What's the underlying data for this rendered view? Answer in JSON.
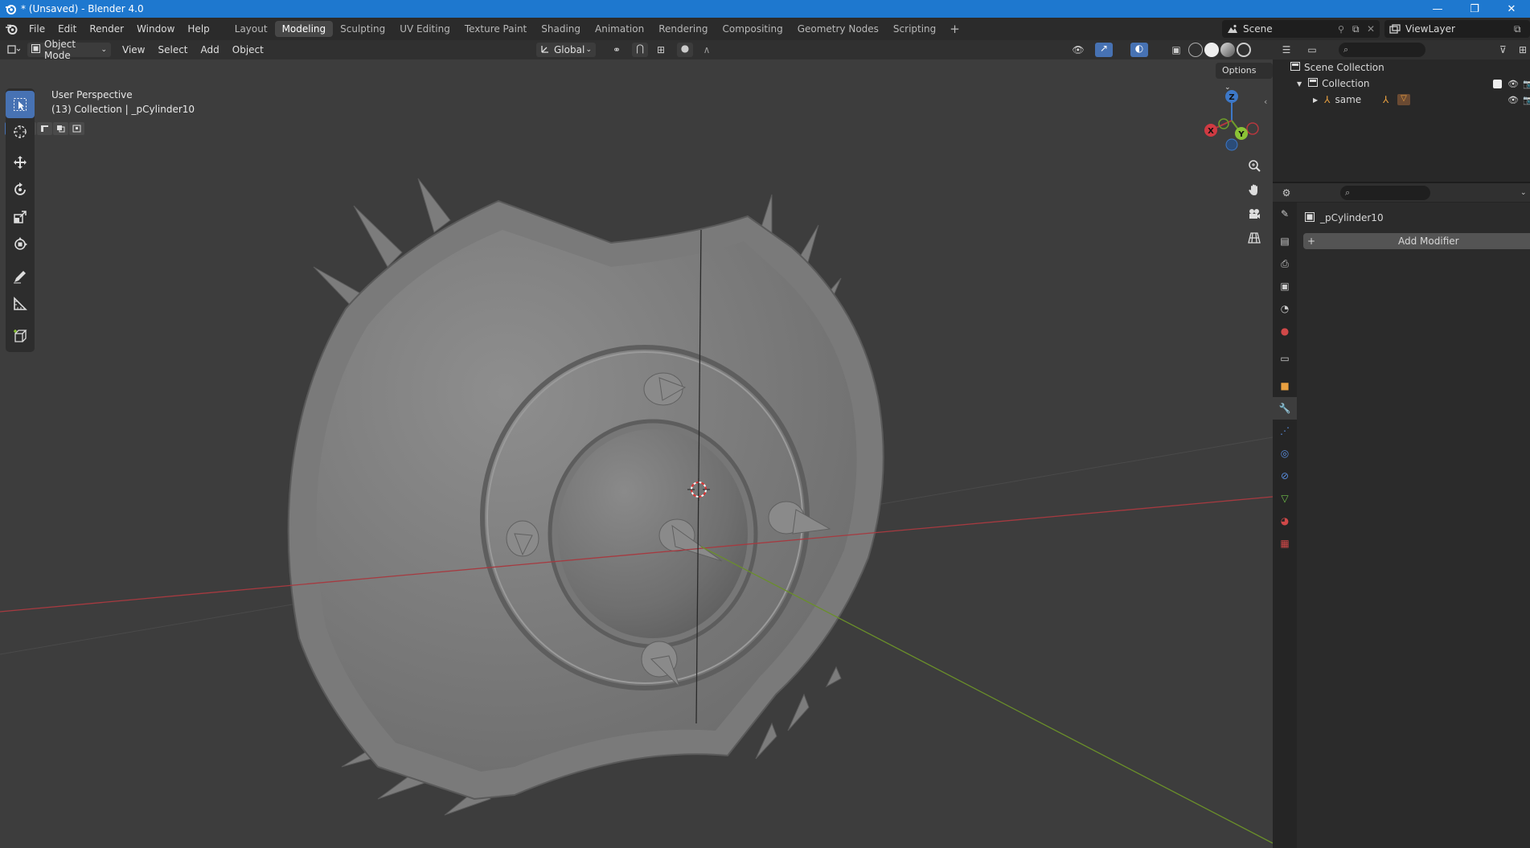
{
  "window": {
    "title": "* (Unsaved) - Blender 4.0",
    "minimize": "—",
    "maximize": "❐",
    "close": "✕"
  },
  "menu": [
    "File",
    "Edit",
    "Render",
    "Window",
    "Help"
  ],
  "workspaces": [
    "Layout",
    "Modeling",
    "Sculpting",
    "UV Editing",
    "Texture Paint",
    "Shading",
    "Animation",
    "Rendering",
    "Compositing",
    "Geometry Nodes",
    "Scripting"
  ],
  "workspace_active": "Modeling",
  "workspace_add": "+",
  "scene": {
    "name": "Scene"
  },
  "view_layer": {
    "name": "ViewLayer"
  },
  "header": {
    "mode": "Object Mode",
    "view": "View",
    "select": "Select",
    "add": "Add",
    "object": "Object",
    "transform": "Global"
  },
  "viewport": {
    "perspective": "User Perspective",
    "collection_info": "(13) Collection | _pCylinder10",
    "options": "Options",
    "gizmo": {
      "x": "X",
      "y": "Y",
      "z": "Z"
    }
  },
  "outliner": {
    "scene_collection": "Scene Collection",
    "collection": "Collection",
    "object": "same"
  },
  "properties": {
    "object_name": "_pCylinder10",
    "add_modifier": "Add Modifier",
    "add_icon": "+"
  },
  "colors": {
    "titlebar": "#1e78cf",
    "viewport_bg": "#3d3d3d",
    "accent": "#4772b3",
    "x_axis": "#b5383e",
    "y_axis": "#6f9c2a",
    "z_axis": "#3d78c8"
  },
  "icons": {
    "toolbar": [
      "select-box-icon",
      "cursor-icon",
      "move-icon",
      "rotate-icon",
      "scale-icon",
      "transform-icon",
      "annotate-icon",
      "measure-icon",
      "add-cube-icon"
    ],
    "properties_tabs": [
      "tool-icon",
      "render-icon",
      "output-icon",
      "view-layer-icon",
      "scene-icon",
      "world-icon",
      "collection-icon",
      "object-icon",
      "modifier-icon",
      "particles-icon",
      "physics-icon",
      "constraints-icon",
      "data-icon",
      "material-icon",
      "texture-icon"
    ]
  }
}
